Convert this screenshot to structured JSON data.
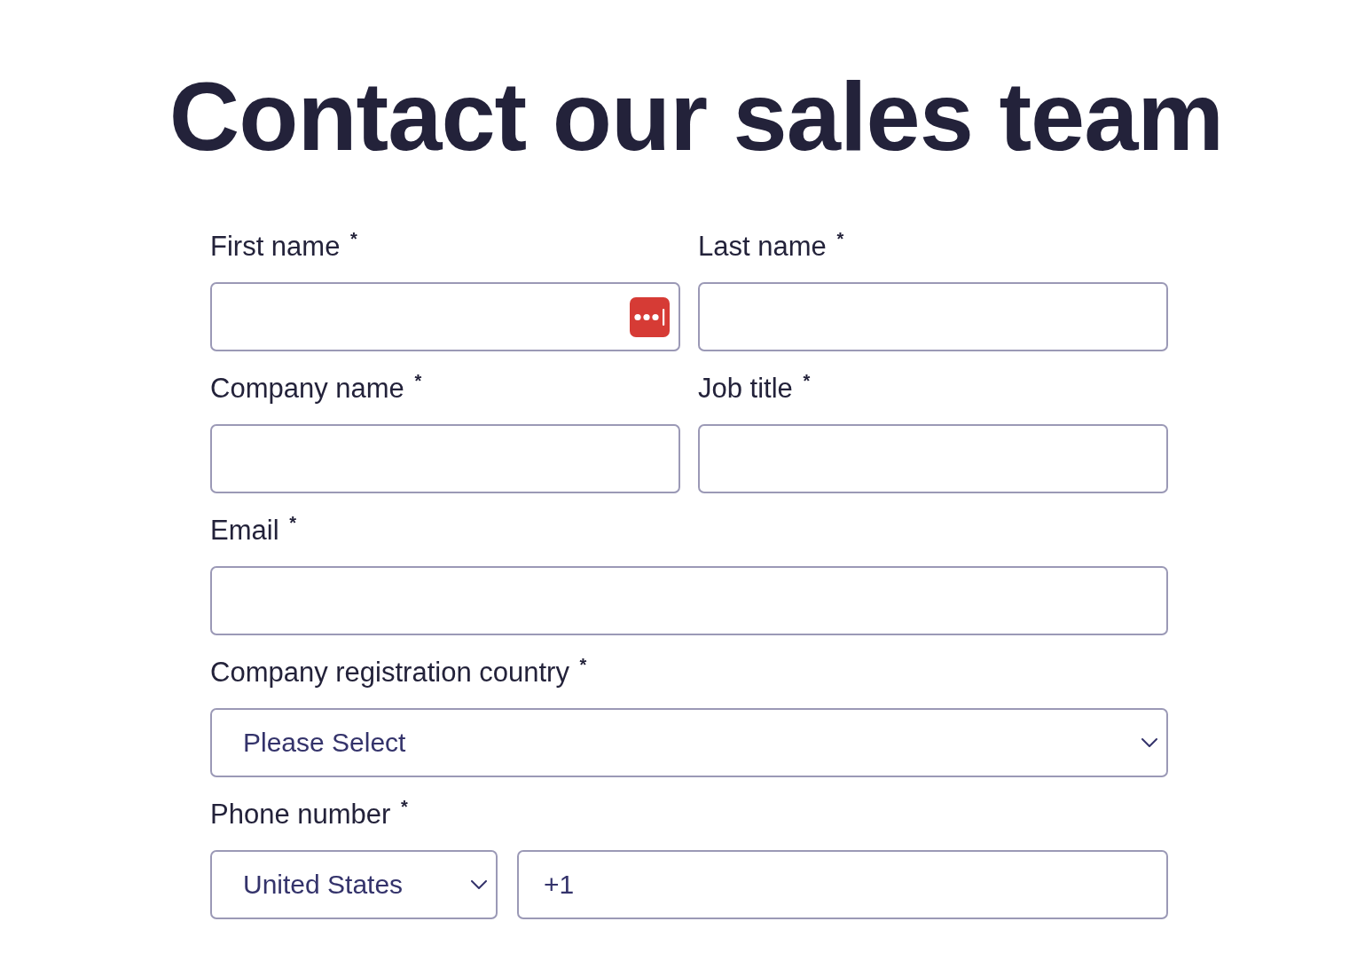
{
  "heading": "Contact our sales team",
  "form": {
    "rows": [
      [
        {
          "kind": "text",
          "label": "First name $^{*}$",
          "password_manager_badge": true
        },
        {
          "kind": "text",
          "label": "Last name $^{*}$"
        }
      ],
      [
        {
          "kind": "text",
          "label": "Company name $^{*}$"
        },
        {
          "kind": "text",
          "label": "Job title $^{*}$"
        }
      ],
      [
        {
          "kind": "text",
          "label": "Email $^{*}$"
        }
      ],
      [
        {
          "kind": "select",
          "label": "Company registration country $^{*}$",
          "value": "Please Select"
        }
      ],
      [
        {
          "kind": "phone",
          "label": "Phone number $^{*}$",
          "country": "United States",
          "value": "+1"
        }
      ]
    ]
  }
}
